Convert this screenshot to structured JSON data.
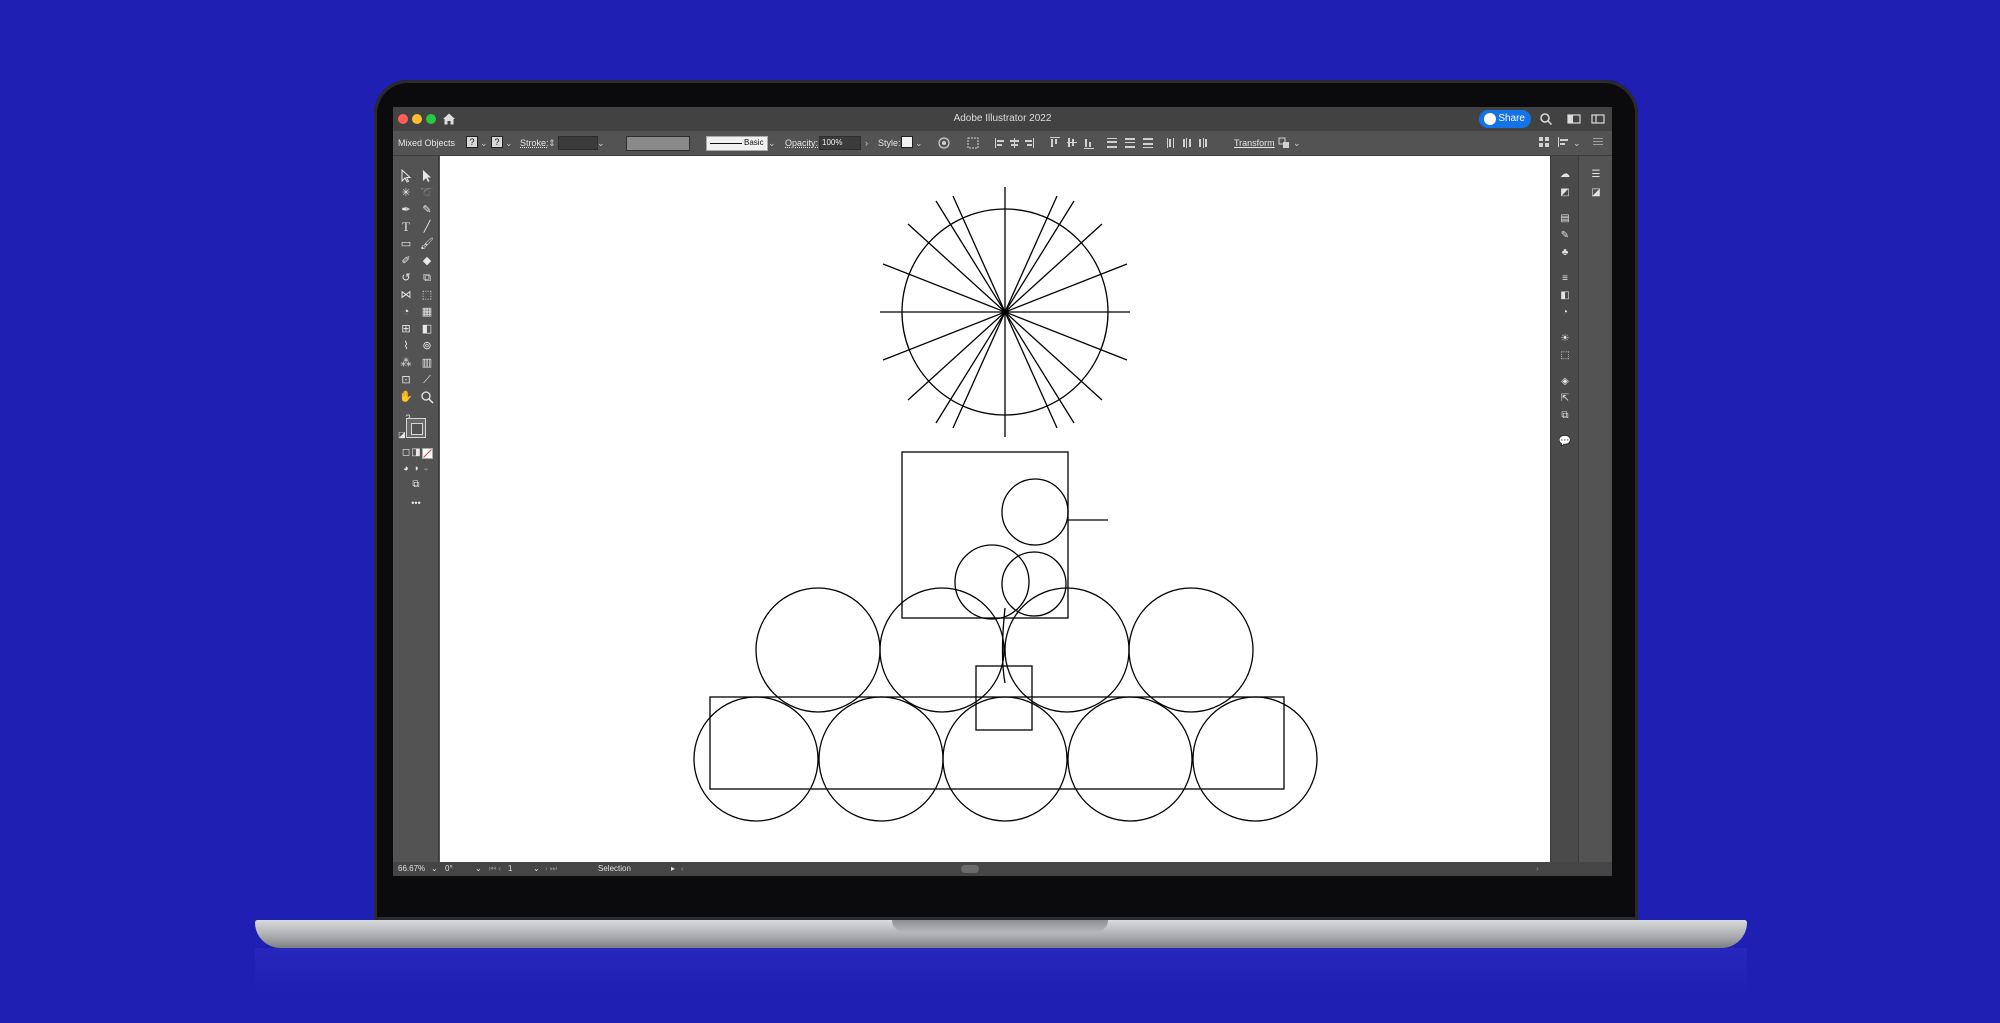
{
  "app": {
    "title": "Adobe Illustrator 2022",
    "share_label": "Share"
  },
  "control_bar": {
    "selection_type": "Mixed Objects",
    "fill_label": "?",
    "stroke_color_label": "?",
    "stroke_label": "Stroke:",
    "brush_label": "Basic",
    "opacity_label": "Opacity:",
    "opacity_value": "100%",
    "style_label": "Style:",
    "transform_label": "Transform"
  },
  "status_bar": {
    "zoom": "66.67%",
    "rotation": "0°",
    "artboard": "1",
    "tool": "Selection"
  },
  "toolbar": {
    "unknown_swatch": "?",
    "more": "•••"
  },
  "colors": {
    "background": "#1f1fb4",
    "ui_dark": "#535353",
    "share_button": "#1473e6",
    "canvas": "#ffffff",
    "stroke": "#000000"
  }
}
